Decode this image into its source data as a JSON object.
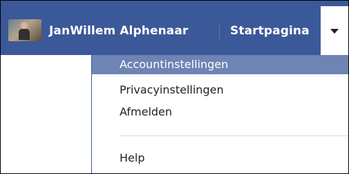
{
  "topbar": {
    "user_name": "JanWillem Alphenaar",
    "home_label": "Startpagina",
    "dropdown_icon": "caret-down-icon",
    "avatar_icon": "profile-photo",
    "background_color": "#3b5998"
  },
  "menu": {
    "items": [
      {
        "label": "Accountinstellingen",
        "highlighted": true
      },
      {
        "label": "Privacyinstellingen",
        "highlighted": false
      },
      {
        "label": "Afmelden",
        "highlighted": false
      },
      {
        "label": "Help",
        "highlighted": false
      }
    ],
    "highlight_color": "#6d84b4"
  }
}
